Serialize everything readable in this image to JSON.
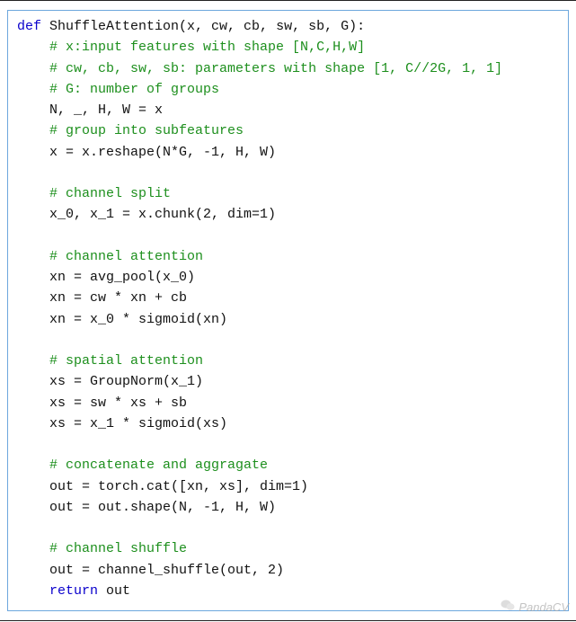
{
  "code": {
    "lines": [
      {
        "indent": 0,
        "type": "sig",
        "kw": "def",
        "name": "ShuffleAttention",
        "params": "(x, cw, cb, sw, sb, G):"
      },
      {
        "indent": 1,
        "type": "comment",
        "text": "# x:input features with shape [N,C,H,W]"
      },
      {
        "indent": 1,
        "type": "comment",
        "text": "# cw, cb, sw, sb: parameters with shape [1, C//2G, 1, 1]"
      },
      {
        "indent": 1,
        "type": "comment",
        "text": "# G: number of groups"
      },
      {
        "indent": 1,
        "type": "plain",
        "text": "N, _, H, W = x"
      },
      {
        "indent": 1,
        "type": "comment",
        "text": "# group into subfeatures"
      },
      {
        "indent": 1,
        "type": "plain",
        "text": "x = x.reshape(N*G, -1, H, W)"
      },
      {
        "indent": 1,
        "type": "blank"
      },
      {
        "indent": 1,
        "type": "comment",
        "text": "# channel split"
      },
      {
        "indent": 1,
        "type": "plain",
        "text": "x_0, x_1 = x.chunk(2, dim=1)"
      },
      {
        "indent": 1,
        "type": "blank"
      },
      {
        "indent": 1,
        "type": "comment",
        "text": "# channel attention"
      },
      {
        "indent": 1,
        "type": "plain",
        "text": "xn = avg_pool(x_0)"
      },
      {
        "indent": 1,
        "type": "plain",
        "text": "xn = cw * xn + cb"
      },
      {
        "indent": 1,
        "type": "plain",
        "text": "xn = x_0 * sigmoid(xn)"
      },
      {
        "indent": 1,
        "type": "blank"
      },
      {
        "indent": 1,
        "type": "comment",
        "text": "# spatial attention"
      },
      {
        "indent": 1,
        "type": "plain",
        "text": "xs = GroupNorm(x_1)"
      },
      {
        "indent": 1,
        "type": "plain",
        "text": "xs = sw * xs + sb"
      },
      {
        "indent": 1,
        "type": "plain",
        "text": "xs = x_1 * sigmoid(xs)"
      },
      {
        "indent": 1,
        "type": "blank"
      },
      {
        "indent": 1,
        "type": "comment",
        "text": "# concatenate and aggragate"
      },
      {
        "indent": 1,
        "type": "plain",
        "text": "out = torch.cat([xn, xs], dim=1)"
      },
      {
        "indent": 1,
        "type": "plain",
        "text": "out = out.shape(N, -1, H, W)"
      },
      {
        "indent": 1,
        "type": "blank"
      },
      {
        "indent": 1,
        "type": "comment",
        "text": "# channel shuffle"
      },
      {
        "indent": 1,
        "type": "plain",
        "text": "out = channel_shuffle(out, 2)"
      },
      {
        "indent": 1,
        "type": "return",
        "kw": "return",
        "text": " out"
      }
    ]
  },
  "watermark": {
    "text": "PandaCV"
  },
  "colors": {
    "keyword": "#0a00cc",
    "comment": "#1d8f1d",
    "border": "#6da7dd"
  }
}
